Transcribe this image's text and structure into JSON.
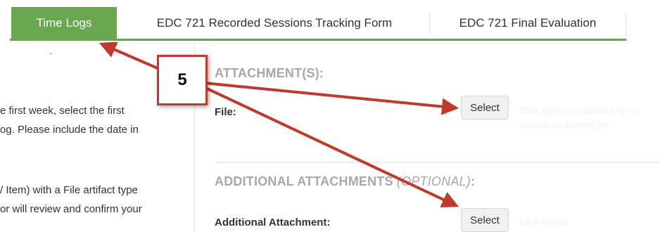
{
  "tabs": [
    {
      "label": "Time Logs",
      "active": true
    },
    {
      "label": "EDC 721 Recorded Sessions Tracking Form",
      "active": false
    },
    {
      "label": "EDC 721 Final Evaluation",
      "active": false
    }
  ],
  "left_instructions": {
    "line1": "e first week, select the first",
    "line2": "og. Please include the date in",
    "line3": "/ Item) with a File artifact type",
    "line4": "or will review and confirm your"
  },
  "attachments": {
    "title": "ATTACHMENT(S):",
    "file_label": "File:",
    "select_label": "Select",
    "hint_line1": "Click Select to upload a file or",
    "hint_line2": "choose an existing file"
  },
  "additional": {
    "title_main": "ADDITIONAL ATTACHMENTS ",
    "title_optional": "(OPTIONAL)",
    "title_suffix": ":",
    "field_label": "Additional Attachment:",
    "select_label": "Select",
    "hint": "Click Select"
  },
  "callout": {
    "number": "5"
  },
  "colors": {
    "tab_active": "#6aa84f",
    "callout_border": "#c0392b",
    "arrow": "#c0392b"
  }
}
